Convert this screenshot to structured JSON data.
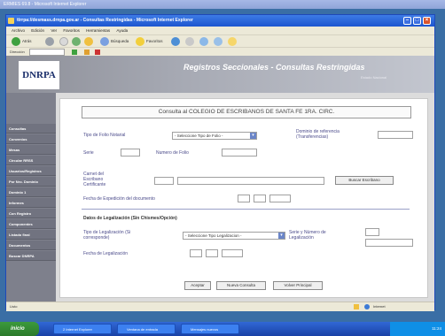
{
  "outer_window": {
    "title": "ERMIES 69.8 - Microsoft Internet Explorer"
  },
  "browser": {
    "title": "ttrrpa://desmass.drnpa.gov.ar - Consultas Restringidas - Microsoft Internet Explorer",
    "menu": [
      "Archivo",
      "Edición",
      "Ver",
      "Favoritos",
      "Herramientas",
      "Ayuda"
    ],
    "toolbar": {
      "back": "Atrás",
      "search": "Búsqueda",
      "favorites": "Favoritos"
    },
    "address_label": "Dirección",
    "status_text": "Listo",
    "zone_text": "Internet"
  },
  "site": {
    "logo": "DNRPA",
    "title": "Registros Seccionales - Consultas Restringidas",
    "subtitle": "Estado Nacional"
  },
  "sidebar": {
    "items": [
      {
        "label": "Consultas"
      },
      {
        "label": "Convenios"
      },
      {
        "label": "Mesas"
      },
      {
        "label": "Circular RRSS"
      },
      {
        "label": "Usuarios/Registros"
      },
      {
        "label": "Por Nro. Dominio"
      },
      {
        "label": "Dominio 1"
      },
      {
        "label": "Informes"
      },
      {
        "label": "Con Registro"
      },
      {
        "label": "Componentes"
      },
      {
        "label": "Listado final"
      },
      {
        "label": "Documentos"
      },
      {
        "label": "Buscar DNRPA"
      }
    ]
  },
  "form": {
    "title": "Consulta al COLEGIO DE ESCRIBANOS DE SANTA FE 1RA. CIRC.",
    "tipo_folio_label": "Tipo de Folio Notarial",
    "tipo_folio_value": "- Seleccione Tipo de Folio -",
    "dominio_label": "Dominio de referencia (Transferencias)",
    "dominio_value": "",
    "serie_label": "Serie",
    "serie_value": "",
    "numero_folio_label": "Numero de Folio",
    "numero_folio_value": "",
    "carnet_label": "Carnet del Escribano Certificante",
    "carnet_value": "",
    "buscar_escribano_label": "Buscar Escribano",
    "fecha_expedicion_label": "Fecha de Expedición del documento",
    "fecha_expedicion_dd": "",
    "fecha_expedicion_mm": "",
    "fecha_expedicion_aaaa": "",
    "legalizacion_heading": "Datos de Legalización (Sin Chismes/Opción)",
    "tipo_legalizacion_label": "Tipo de Legalización (Si corresponde)",
    "tipo_legalizacion_value": "- Seleccione Tipo Legalizacion -",
    "serie_numero_leg_label": "Serie y Número de Legalización",
    "serie_leg_value": "",
    "numero_leg_value": "",
    "fecha_legalizacion_label": "Fecha de Legalización",
    "fecha_leg_dd": "",
    "fecha_leg_mm": "",
    "fecha_leg_aaaa": "",
    "btn_aceptar": "Aceptar",
    "btn_nueva": "Nueva Consulta",
    "btn_volver": "Volver Principal"
  },
  "taskbar": {
    "start": "inicio",
    "tasks": [
      "2 Internet Explorer",
      "Ventana de entrada",
      "Mensajes nuevos"
    ],
    "clock": "11:24"
  }
}
